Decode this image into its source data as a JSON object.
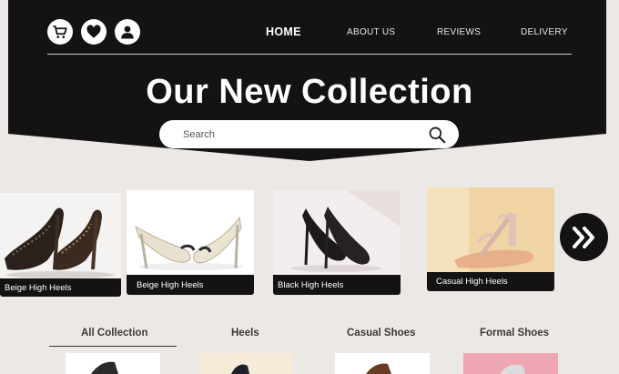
{
  "nav": {
    "icons": [
      "cart-icon",
      "heart-icon",
      "user-icon"
    ],
    "items": [
      {
        "label": "HOME",
        "active": true
      },
      {
        "label": "ABOUT US",
        "active": false
      },
      {
        "label": "REVIEWS",
        "active": false
      },
      {
        "label": "DELIVERY",
        "active": false
      }
    ]
  },
  "hero": {
    "title": "Our New Collection"
  },
  "search": {
    "placeholder": "Search"
  },
  "products": [
    {
      "label": "Beige High Heels"
    },
    {
      "label": "Beige High Heels"
    },
    {
      "label": "Black High Heels"
    },
    {
      "label": "Casual High Heels"
    }
  ],
  "categories": {
    "tabs": [
      {
        "label": "All Collection",
        "active": true
      },
      {
        "label": "Heels",
        "active": false
      },
      {
        "label": "Casual Shoes",
        "active": false
      },
      {
        "label": "Formal Shoes",
        "active": false
      }
    ]
  },
  "colors": {
    "dark": "#141212",
    "background": "#ebe8e6"
  }
}
